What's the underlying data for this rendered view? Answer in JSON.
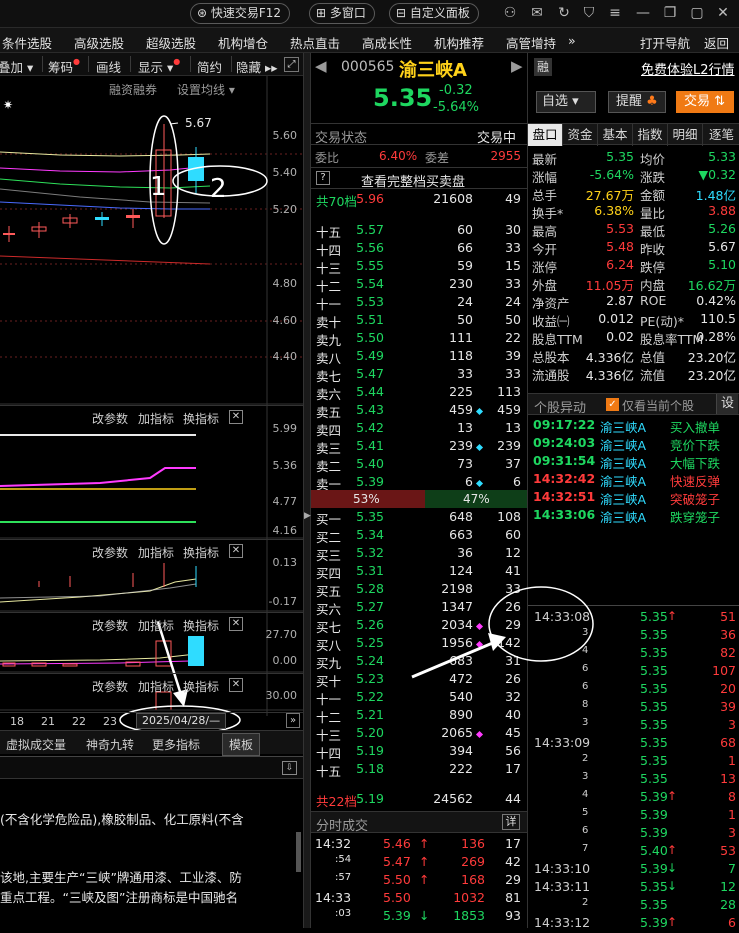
{
  "topbar": {
    "quick_trade": "快速交易F12",
    "multi_window": "多窗口",
    "custom_panel": "自定义面板"
  },
  "menu": [
    "条件选股",
    "高级选股",
    "超级选股",
    "机构增仓",
    "热点直击",
    "高成长性",
    "机构推荐",
    "高管增持",
    "»",
    "打开导航",
    "返回"
  ],
  "left_toolbar": {
    "overlay": "叠加",
    "chips": "筹码",
    "draw": "画线",
    "display": "显示",
    "simple": "简约",
    "hide": "隐藏"
  },
  "chart": {
    "margin_label": "融资融券",
    "ma_label": "设置均线",
    "peak_label": "5.67",
    "ann1": "1",
    "ann2": "2",
    "main_axis": [
      "5.60",
      "5.40",
      "5.20",
      "4.80",
      "4.60",
      "4.40"
    ],
    "ind1_axis": [
      "5.99",
      "5.36",
      "4.77",
      "4.16"
    ],
    "ind2_axis": [
      "0.13",
      "-0.17"
    ],
    "ind3_axis": [
      "27.70",
      "0.00"
    ],
    "ind4_axis": [
      "30.00"
    ],
    "panel_btns": {
      "params": "改参数",
      "add": "加指标",
      "swap": "换指标"
    },
    "x_dates": [
      "18",
      "21",
      "22",
      "23"
    ],
    "date_box": "2025/04/28/—"
  },
  "dock_tabs": [
    "虚拟成交量",
    "神奇九转",
    "更多指标",
    "模板"
  ],
  "company_text": [
    "(不含化学危险品),橡胶制品、化工原料(不含",
    "该地,主要生产“三峡”牌通用漆、工业漆、防",
    "重点工程。“三峡及图”注册商标是中国驰名"
  ],
  "stock": {
    "code": "000565",
    "name": "渝三峡A",
    "badge": "融",
    "l2": "免费体验L2行情",
    "price": "5.35",
    "change": "-0.32",
    "pct": "-5.64%",
    "watch": "自选",
    "alert": "提醒",
    "trade": "交易"
  },
  "book": {
    "state_label": "交易状态",
    "state_value": "交易中",
    "ratio_label": "委比",
    "ratio_value": "6.40%",
    "diff_label": "委差",
    "diff_value": "2955",
    "full_btn": "查看完整档买卖盘",
    "help": "?",
    "top_summary": {
      "label": "共70档",
      "price": "5.96",
      "vol": "21608",
      "n": "49"
    },
    "sells": [
      {
        "l": "十五",
        "p": "5.57",
        "v": "60",
        "n": "30",
        "dot": ""
      },
      {
        "l": "十四",
        "p": "5.56",
        "v": "66",
        "n": "33",
        "dot": ""
      },
      {
        "l": "十三",
        "p": "5.55",
        "v": "59",
        "n": "15",
        "dot": ""
      },
      {
        "l": "十二",
        "p": "5.54",
        "v": "230",
        "n": "33",
        "dot": ""
      },
      {
        "l": "十一",
        "p": "5.53",
        "v": "24",
        "n": "24",
        "dot": ""
      },
      {
        "l": "卖十",
        "p": "5.51",
        "v": "50",
        "n": "50",
        "dot": ""
      },
      {
        "l": "卖九",
        "p": "5.50",
        "v": "111",
        "n": "22",
        "dot": ""
      },
      {
        "l": "卖八",
        "p": "5.49",
        "v": "118",
        "n": "39",
        "dot": ""
      },
      {
        "l": "卖七",
        "p": "5.47",
        "v": "33",
        "n": "33",
        "dot": ""
      },
      {
        "l": "卖六",
        "p": "5.44",
        "v": "225",
        "n": "113",
        "dot": ""
      },
      {
        "l": "卖五",
        "p": "5.43",
        "v": "459",
        "n": "459",
        "dot": "cy"
      },
      {
        "l": "卖四",
        "p": "5.42",
        "v": "13",
        "n": "13",
        "dot": ""
      },
      {
        "l": "卖三",
        "p": "5.41",
        "v": "239",
        "n": "239",
        "dot": "cy"
      },
      {
        "l": "卖二",
        "p": "5.40",
        "v": "73",
        "n": "37",
        "dot": ""
      },
      {
        "l": "卖一",
        "p": "5.39",
        "v": "6",
        "n": "6",
        "dot": "cy"
      }
    ],
    "split": {
      "buy": "53%",
      "sell": "47%",
      "buy_frac": 0.53
    },
    "buys": [
      {
        "l": "买一",
        "p": "5.35",
        "v": "648",
        "n": "108",
        "dot": ""
      },
      {
        "l": "买二",
        "p": "5.34",
        "v": "663",
        "n": "60",
        "dot": ""
      },
      {
        "l": "买三",
        "p": "5.32",
        "v": "36",
        "n": "12",
        "dot": ""
      },
      {
        "l": "买四",
        "p": "5.31",
        "v": "124",
        "n": "41",
        "dot": ""
      },
      {
        "l": "买五",
        "p": "5.28",
        "v": "2198",
        "n": "33",
        "dot": ""
      },
      {
        "l": "买六",
        "p": "5.27",
        "v": "1347",
        "n": "26",
        "dot": ""
      },
      {
        "l": "买七",
        "p": "5.26",
        "v": "2034",
        "n": "29",
        "dot": "mg"
      },
      {
        "l": "买八",
        "p": "5.25",
        "v": "1956",
        "n": "142",
        "dot": "mg"
      },
      {
        "l": "买九",
        "p": "5.24",
        "v": "683",
        "n": "31",
        "dot": ""
      },
      {
        "l": "买十",
        "p": "5.23",
        "v": "472",
        "n": "26",
        "dot": ""
      },
      {
        "l": "十一",
        "p": "5.22",
        "v": "540",
        "n": "32",
        "dot": ""
      },
      {
        "l": "十二",
        "p": "5.21",
        "v": "890",
        "n": "40",
        "dot": ""
      },
      {
        "l": "十三",
        "p": "5.20",
        "v": "2065",
        "n": "45",
        "dot": "mg"
      },
      {
        "l": "十四",
        "p": "5.19",
        "v": "394",
        "n": "56",
        "dot": ""
      },
      {
        "l": "十五",
        "p": "5.18",
        "v": "222",
        "n": "17",
        "dot": ""
      }
    ],
    "bottom_summary": {
      "label": "共22档",
      "price": "5.19",
      "vol": "24562",
      "n": "44"
    }
  },
  "minute": {
    "title": "分时成交",
    "detail": "详",
    "rows": [
      {
        "t": "14:32",
        "p": "5.46",
        "a": "↑",
        "v": "136",
        "n": "17",
        "pc": "up",
        "vc": "up"
      },
      {
        "t": ":54",
        "p": "5.47",
        "a": "↑",
        "v": "269",
        "n": "42",
        "pc": "up",
        "vc": "up"
      },
      {
        "t": ":57",
        "p": "5.50",
        "a": "↑",
        "v": "168",
        "n": "29",
        "pc": "up",
        "vc": "up"
      },
      {
        "t": "14:33",
        "p": "5.50",
        "a": "",
        "v": "1032",
        "n": "81",
        "pc": "up",
        "vc": "up"
      },
      {
        "t": ":03",
        "p": "5.39",
        "a": "↓",
        "v": "1853",
        "n": "93",
        "pc": "dn",
        "vc": "dn"
      }
    ]
  },
  "tabs": [
    "盘口",
    "资金",
    "基本",
    "指数",
    "明细",
    "逐笔"
  ],
  "quote": [
    {
      "k1": "最新",
      "v1": "5.35",
      "c1": "dn",
      "k2": "均价",
      "v2": "5.33",
      "c2": "dn"
    },
    {
      "k1": "涨幅",
      "v1": "-5.64%",
      "c1": "dn",
      "k2": "涨跌",
      "v2": "▼0.32",
      "c2": "dn"
    },
    {
      "k1": "总手",
      "v1": "27.67万",
      "c1": "yel",
      "k2": "金额",
      "v2": "1.48亿",
      "c2": "cy"
    },
    {
      "k1": "换手*",
      "v1": "6.38%",
      "c1": "yel",
      "k2": "量比",
      "v2": "3.88",
      "c2": "up"
    },
    {
      "k1": "最高",
      "v1": "5.53",
      "c1": "up",
      "k2": "最低",
      "v2": "5.26",
      "c2": "dn"
    },
    {
      "k1": "今开",
      "v1": "5.48",
      "c1": "up",
      "k2": "昨收",
      "v2": "5.67",
      "c2": "wh"
    },
    {
      "k1": "涨停",
      "v1": "6.24",
      "c1": "up",
      "k2": "跌停",
      "v2": "5.10",
      "c2": "dn"
    },
    {
      "k1": "外盘",
      "v1": "11.05万",
      "c1": "up",
      "k2": "内盘",
      "v2": "16.62万",
      "c2": "dn"
    },
    {
      "k1": "净资产",
      "v1": "2.87",
      "c1": "wh",
      "k2": "ROE",
      "v2": "0.42%",
      "c2": "wh"
    },
    {
      "k1": "收益㈠",
      "v1": "0.012",
      "c1": "wh",
      "k2": "PE(动)*",
      "v2": "110.5",
      "c2": "wh"
    },
    {
      "k1": "股息TTM",
      "v1": "0.02",
      "c1": "wh",
      "k2": "股息率TTM",
      "v2": "0.28%",
      "c2": "wh"
    },
    {
      "k1": "总股本",
      "v1": "4.336亿",
      "c1": "wh",
      "k2": "总值",
      "v2": "23.20亿",
      "c2": "wh"
    },
    {
      "k1": "流通股",
      "v1": "4.336亿",
      "c1": "wh",
      "k2": "流值",
      "v2": "23.20亿",
      "c2": "wh"
    }
  ],
  "alerts": {
    "title": "个股异动",
    "only_current": "仅看当前个股",
    "settings": "设",
    "rows": [
      {
        "t": "09:17:22",
        "n": "渝三峡A",
        "e": "买入撤单",
        "c": "dn"
      },
      {
        "t": "09:24:03",
        "n": "渝三峡A",
        "e": "竞价下跌",
        "c": "dn"
      },
      {
        "t": "09:31:54",
        "n": "渝三峡A",
        "e": "大幅下跌",
        "c": "dn"
      },
      {
        "t": "14:32:42",
        "n": "渝三峡A",
        "e": "快速反弹",
        "c": "up"
      },
      {
        "t": "14:32:51",
        "n": "渝三峡A",
        "e": "突破笼子",
        "c": "up"
      },
      {
        "t": "14:33:06",
        "n": "渝三峡A",
        "e": "跌穿笼子",
        "c": "dn"
      }
    ]
  },
  "ticks": [
    {
      "t": "14:33:08",
      "p": "5.35",
      "a": "↑",
      "v": "51",
      "pc": "dn",
      "ac": "up",
      "vc": "up"
    },
    {
      "t": "3",
      "p": "5.35",
      "a": "",
      "v": "36",
      "pc": "dn",
      "ac": "",
      "vc": "up"
    },
    {
      "t": "4",
      "p": "5.35",
      "a": "",
      "v": "82",
      "pc": "dn",
      "ac": "",
      "vc": "up"
    },
    {
      "t": "6",
      "p": "5.35",
      "a": "",
      "v": "107",
      "pc": "dn",
      "ac": "",
      "vc": "up"
    },
    {
      "t": "6",
      "p": "5.35",
      "a": "",
      "v": "20",
      "pc": "dn",
      "ac": "",
      "vc": "up"
    },
    {
      "t": "8",
      "p": "5.35",
      "a": "",
      "v": "39",
      "pc": "dn",
      "ac": "",
      "vc": "up"
    },
    {
      "t": "3",
      "p": "5.35",
      "a": "",
      "v": "3",
      "pc": "dn",
      "ac": "",
      "vc": "up"
    },
    {
      "t": "14:33:09",
      "p": "5.35",
      "a": "",
      "v": "68",
      "pc": "dn",
      "ac": "",
      "vc": "up"
    },
    {
      "t": "2",
      "p": "5.35",
      "a": "",
      "v": "1",
      "pc": "dn",
      "ac": "",
      "vc": "up"
    },
    {
      "t": "3",
      "p": "5.35",
      "a": "",
      "v": "13",
      "pc": "dn",
      "ac": "",
      "vc": "up"
    },
    {
      "t": "4",
      "p": "5.39",
      "a": "↑",
      "v": "8",
      "pc": "dn",
      "ac": "up",
      "vc": "up"
    },
    {
      "t": "5",
      "p": "5.39",
      "a": "",
      "v": "1",
      "pc": "dn",
      "ac": "",
      "vc": "up"
    },
    {
      "t": "6",
      "p": "5.39",
      "a": "",
      "v": "3",
      "pc": "dn",
      "ac": "",
      "vc": "up"
    },
    {
      "t": "7",
      "p": "5.40",
      "a": "↑",
      "v": "53",
      "pc": "dn",
      "ac": "up",
      "vc": "up"
    },
    {
      "t": "14:33:10",
      "p": "5.39",
      "a": "↓",
      "v": "7",
      "pc": "dn",
      "ac": "dn",
      "vc": "dn"
    },
    {
      "t": "14:33:11",
      "p": "5.35",
      "a": "↓",
      "v": "12",
      "pc": "dn",
      "ac": "dn",
      "vc": "dn"
    },
    {
      "t": "2",
      "p": "5.35",
      "a": "",
      "v": "28",
      "pc": "dn",
      "ac": "",
      "vc": "dn"
    },
    {
      "t": "14:33:12",
      "p": "5.39",
      "a": "↑",
      "v": "6",
      "pc": "dn",
      "ac": "up",
      "vc": "up"
    }
  ],
  "colors": {
    "up": "#ff3b3b",
    "down": "#1ed760",
    "yellow": "#ffd21a",
    "cyan": "#2fdcff",
    "magenta": "#ff3bff"
  }
}
